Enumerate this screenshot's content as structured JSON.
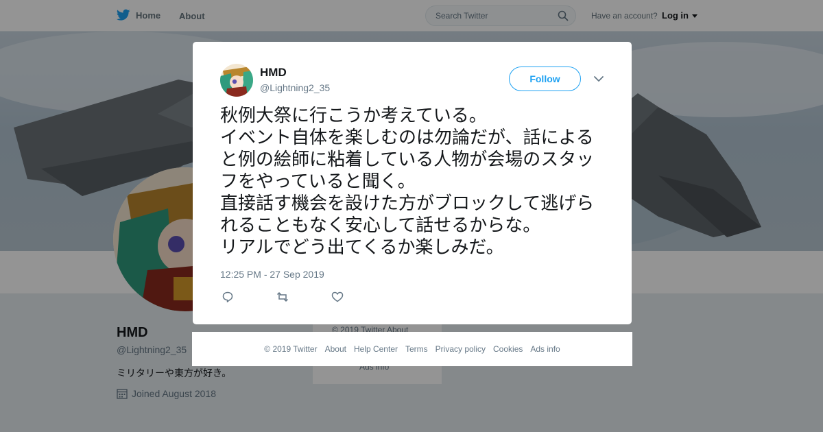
{
  "nav": {
    "home_label": "Home",
    "about_label": "About",
    "search_placeholder": "Search Twitter",
    "account_prompt": "Have an account?",
    "login_label": "Log in"
  },
  "profile": {
    "name": "HMD",
    "handle": "@Lightning2_35",
    "bio": "ミリタリーや東方が好き。",
    "joined": "Joined August 2018"
  },
  "side_card": {
    "line1": "© 2019 Twitter   About",
    "line2": "Ads info"
  },
  "tweet": {
    "name": "HMD",
    "handle": "@Lightning2_35",
    "follow_label": "Follow",
    "text": "秋例大祭に行こうか考えている。\nイベント自体を楽しむのは勿論だが、話によると例の絵師に粘着している人物が会場のスタッフをやっていると聞く。\n直接話す機会を設けた方がブロックして逃げられることもなく安心して話せるからな。\nリアルでどう出てくるか楽しみだ。",
    "timestamp": "12:25 PM - 27 Sep 2019"
  },
  "footer": {
    "copyright": "© 2019 Twitter",
    "about": "About",
    "help": "Help Center",
    "terms": "Terms",
    "privacy": "Privacy policy",
    "cookies": "Cookies",
    "ads": "Ads info"
  },
  "colors": {
    "brand": "#1da1f2",
    "text": "#14171a",
    "secondary_text": "#657786",
    "page_background": "#e6ecf0"
  },
  "icons": {
    "logo": "twitter-bird-icon",
    "search": "search-icon",
    "close": "close-icon",
    "caret": "caret-down-icon",
    "menu": "chevron-down-icon",
    "reply": "reply-icon",
    "retweet": "retweet-icon",
    "like": "heart-icon",
    "calendar": "calendar-icon"
  }
}
